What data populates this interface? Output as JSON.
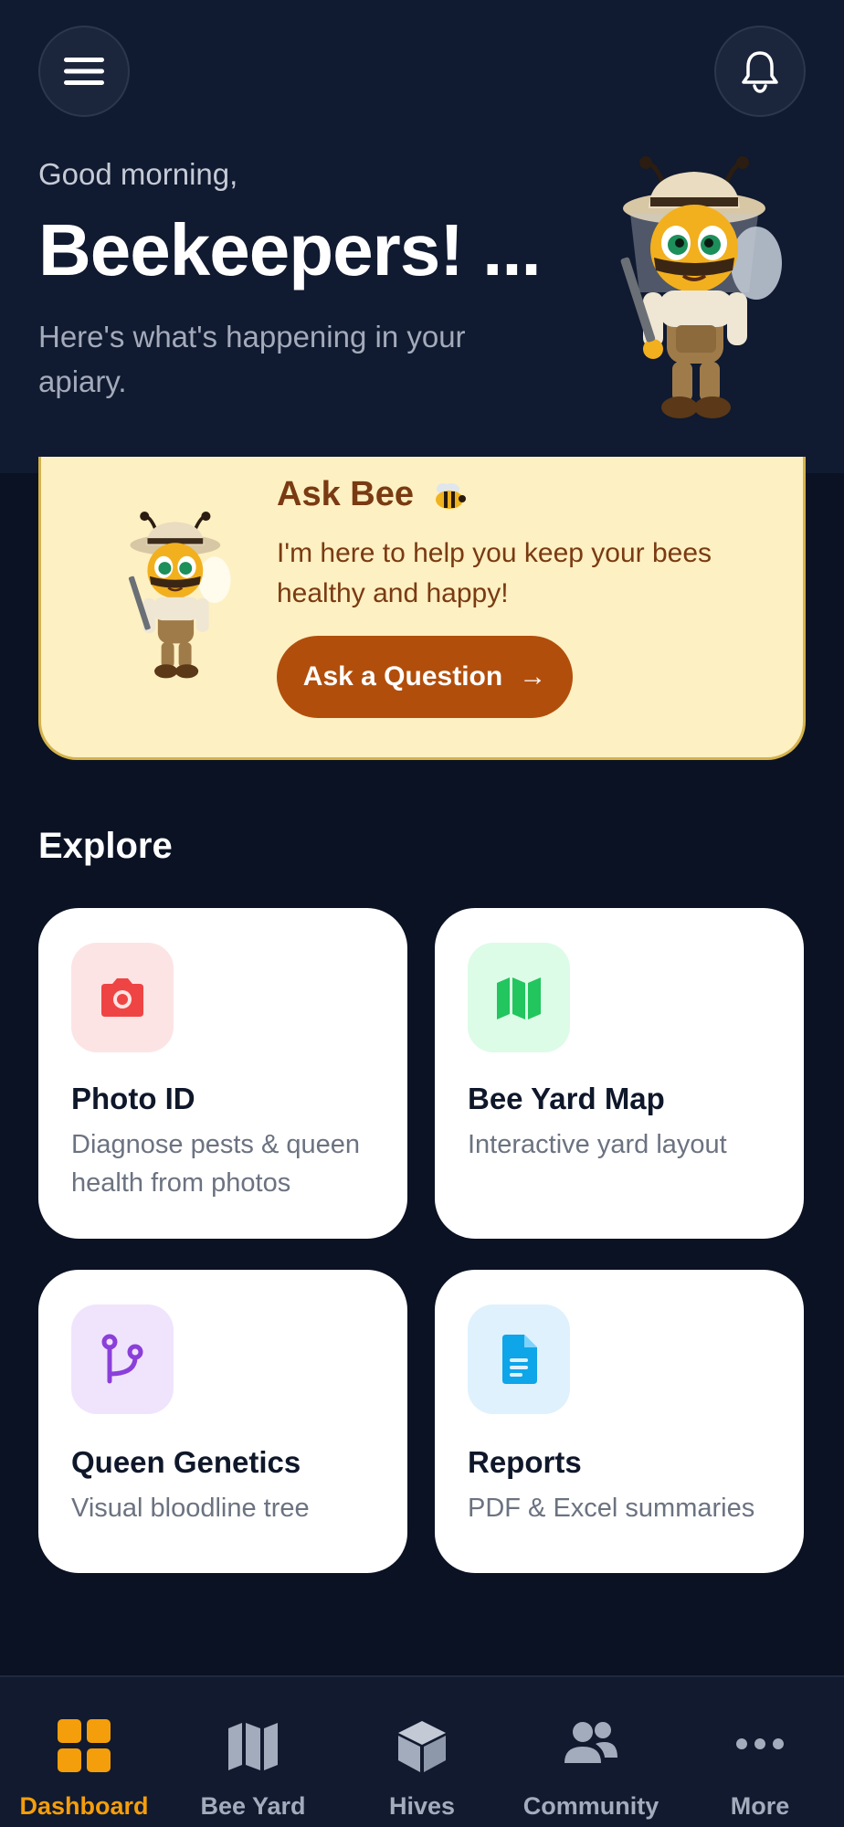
{
  "header": {
    "greeting": "Good morning,",
    "welcome": "Beekeepers! ...",
    "subtitle": "Here's what's happening in your apiary."
  },
  "ask_bee": {
    "title": "Ask Bee",
    "description": "I'm here to help you keep your bees healthy and happy!",
    "button_label": "Ask a Question",
    "button_arrow": "→"
  },
  "explore": {
    "title": "Explore",
    "cards": [
      {
        "title": "Photo ID",
        "description": "Diagnose pests & queen health from photos",
        "icon": "camera-icon"
      },
      {
        "title": "Bee Yard Map",
        "description": "Interactive yard layout",
        "icon": "map-icon"
      },
      {
        "title": "Queen Genetics",
        "description": "Visual bloodline tree",
        "icon": "branch-icon"
      },
      {
        "title": "Reports",
        "description": "PDF & Excel summaries",
        "icon": "document-icon"
      }
    ]
  },
  "nav": {
    "items": [
      {
        "label": "Dashboard",
        "icon": "grid-icon",
        "active": true
      },
      {
        "label": "Bee Yard",
        "icon": "map-icon",
        "active": false
      },
      {
        "label": "Hives",
        "icon": "box-icon",
        "active": false
      },
      {
        "label": "Community",
        "icon": "people-icon",
        "active": false
      },
      {
        "label": "More",
        "icon": "more-icon",
        "active": false
      }
    ]
  },
  "colors": {
    "background": "#0b1224",
    "header": "#101a30",
    "accent": "#f59e0b",
    "ask_card": "#fdf0c2",
    "ask_button": "#b24e0c"
  }
}
